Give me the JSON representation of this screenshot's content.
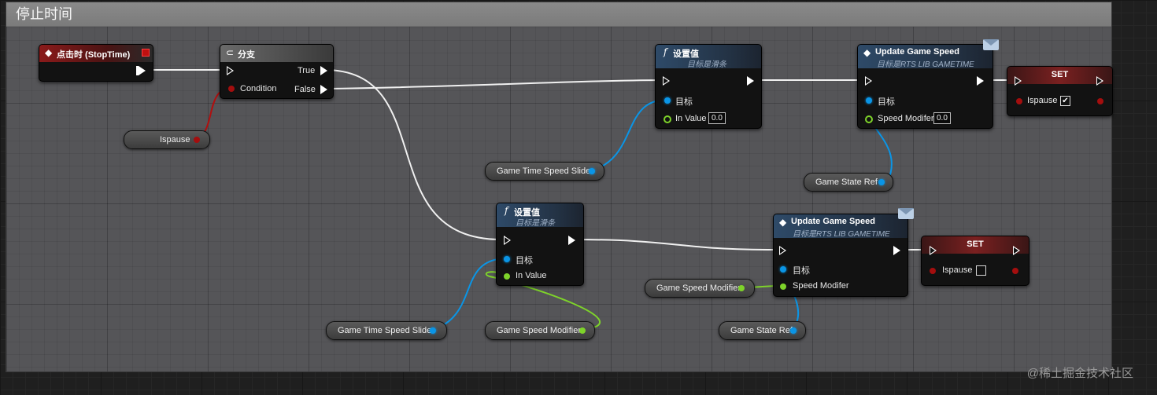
{
  "comment": {
    "title": "停止时间"
  },
  "event_node": {
    "title": "点击时 (StopTime)"
  },
  "branch_node": {
    "title": "分支",
    "true_label": "True",
    "false_label": "False",
    "condition_label": "Condition"
  },
  "getter_ispause": {
    "label": "Ispause"
  },
  "set_value_top": {
    "title": "设置值",
    "subtitle": "目标是滑条",
    "target_label": "目标",
    "in_value_label": "In Value",
    "in_value": "0.0"
  },
  "update_top": {
    "title": "Update Game Speed",
    "subtitle": "目标是RTS LIB GAMETIME",
    "target_label": "目标",
    "speed_label": "Speed Modifer",
    "speed_value": "0.0"
  },
  "set_top": {
    "title": "SET",
    "var_label": "Ispause",
    "checked_glyph": "✔"
  },
  "getter_slider_top": {
    "label": "Game Time Speed Slider"
  },
  "getter_state_top": {
    "label": "Game State Ref"
  },
  "set_value_bottom": {
    "title": "设置值",
    "subtitle": "目标是滑条",
    "target_label": "目标",
    "in_value_label": "In Value"
  },
  "update_bottom": {
    "title": "Update Game Speed",
    "subtitle": "目标是RTS LIB GAMETIME",
    "target_label": "目标",
    "speed_label": "Speed Modifer"
  },
  "set_bottom": {
    "title": "SET",
    "var_label": "Ispause"
  },
  "getter_modifier_mid": {
    "label": "Game Speed Modifier"
  },
  "getter_slider_bottom": {
    "label": "Game Time Speed Slider"
  },
  "getter_modifier_bottom": {
    "label": "Game Speed Modifier"
  },
  "getter_state_bottom": {
    "label": "Game State Ref"
  },
  "watermark": "@稀土掘金技术社区",
  "colors": {
    "exec": "#ffffff",
    "object": "#0a95e6",
    "bool": "#a40e0e",
    "float": "#7ed32a"
  }
}
